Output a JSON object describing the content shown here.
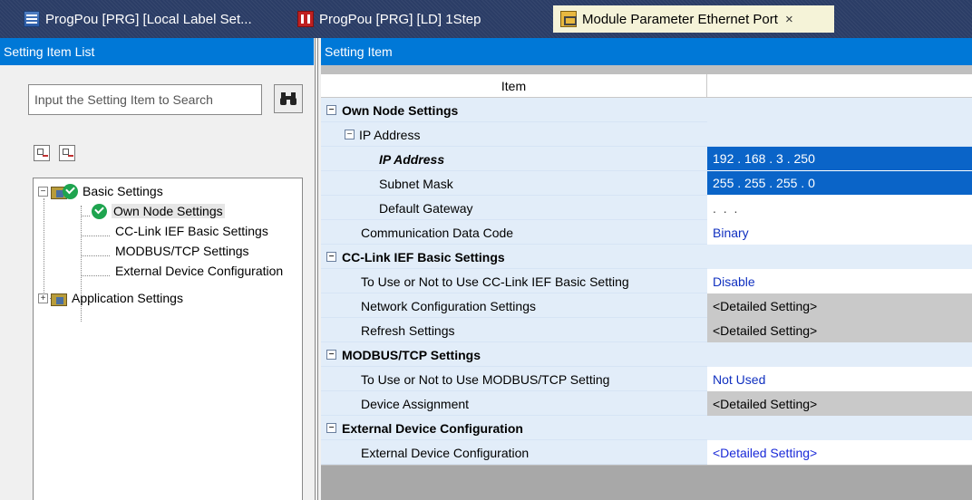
{
  "tabs": [
    {
      "label": "ProgPou [PRG] [Local Label Set...",
      "icon": "local-label-icon"
    },
    {
      "label": "ProgPou [PRG] [LD] 1Step",
      "icon": "ladder-icon"
    },
    {
      "label": "Module Parameter Ethernet Port",
      "icon": "module-parameter-icon",
      "active": true
    }
  ],
  "tab_close": "×",
  "left_panel": {
    "title": "Setting Item List",
    "search_placeholder": "Input the Setting Item to Search",
    "tree": {
      "basic": "Basic Settings",
      "own_node": "Own Node Settings",
      "cclink": "CC-Link IEF Basic Settings",
      "modbus": "MODBUS/TCP Settings",
      "external": "External Device Configuration",
      "application": "Application Settings",
      "collapse_glyph": "−",
      "expand_glyph": "+"
    }
  },
  "right_panel": {
    "title": "Setting Item",
    "column_item": "Item",
    "rows": {
      "own_node": "Own Node Settings",
      "ip_group": "IP Address",
      "ip_address": "IP Address",
      "ip_value": "192 . 168 .   3 . 250",
      "subnet": "Subnet Mask",
      "subnet_value": "255 . 255 . 255 .   0",
      "gateway": "Default Gateway",
      "gateway_value": ".     .     .",
      "comm_code": "Communication Data Code",
      "comm_code_value": "Binary",
      "cclink": "CC-Link IEF Basic Settings",
      "cclink_use": "To Use or Not to Use CC-Link IEF Basic Setting",
      "cclink_use_value": "Disable",
      "network_conf": "Network Configuration Settings",
      "network_conf_value": "<Detailed Setting>",
      "refresh": "Refresh Settings",
      "refresh_value": "<Detailed Setting>",
      "modbus": "MODBUS/TCP Settings",
      "modbus_use": "To Use or Not to Use MODBUS/TCP Setting",
      "modbus_use_value": "Not Used",
      "device_assign": "Device Assignment",
      "device_assign_value": "<Detailed Setting>",
      "external": "External Device Configuration",
      "external_item": "External Device Configuration",
      "external_item_value": "<Detailed Setting>"
    },
    "collapse_glyph": "−"
  },
  "colors": {
    "header_blue": "#0078d7",
    "category_row": "#e2edf9",
    "selected_value": "#0a64c8",
    "link_text": "#1a2ad8",
    "tab_strip": "#2b3d66"
  }
}
